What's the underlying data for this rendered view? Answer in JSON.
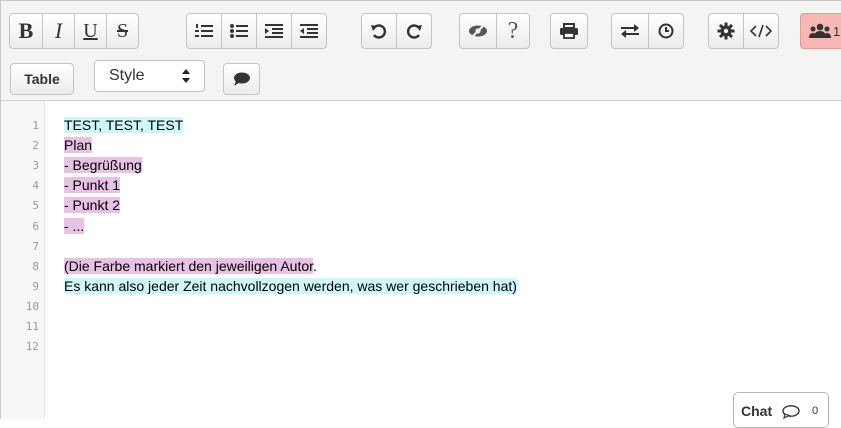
{
  "toolbar": {
    "bold_label": "B",
    "italic_label": "I",
    "underline_label": "U",
    "strike_label": "S",
    "help_label": "?",
    "table_label": "Table",
    "style_select_value": "Style",
    "users_count": "1"
  },
  "editor": {
    "line_numbers": [
      "1",
      "2",
      "3",
      "4",
      "5",
      "6",
      "7",
      "8",
      "9",
      "10",
      "11",
      "12"
    ],
    "lines": [
      {
        "text": "TEST, TEST, TEST",
        "author": "cyan"
      },
      {
        "text": "Plan",
        "author": "pink"
      },
      {
        "text": "- Begrüßung",
        "author": "pink"
      },
      {
        "text": "- Punkt 1",
        "author": "pink"
      },
      {
        "text": "- Punkt 2",
        "author": "pink"
      },
      {
        "text": "- ...",
        "author": "pink"
      },
      {
        "text": "",
        "author": ""
      },
      {
        "text": "(Die Farbe markiert den jeweiligen Autor",
        "author": "pink",
        "tail": "."
      },
      {
        "text": "Es kann also jeder Zeit nachvollzogen werden, was wer geschrieben hat)",
        "author": "cyan"
      },
      {
        "text": "",
        "author": ""
      },
      {
        "text": "",
        "author": ""
      },
      {
        "text": "",
        "author": ""
      }
    ],
    "author_colors": {
      "cyan": "#cff7fa",
      "pink": "#e9c1e4"
    }
  },
  "chat": {
    "label": "Chat",
    "count": "0"
  },
  "icons": [
    "ordered-list-icon",
    "unordered-list-icon",
    "indent-icon",
    "outdent-icon",
    "undo-icon",
    "redo-icon",
    "hide-authorship-icon",
    "print-icon",
    "import-export-icon",
    "timeslider-icon",
    "settings-icon",
    "embed-icon",
    "users-icon",
    "chat-bubble-icon",
    "comment-icon"
  ]
}
